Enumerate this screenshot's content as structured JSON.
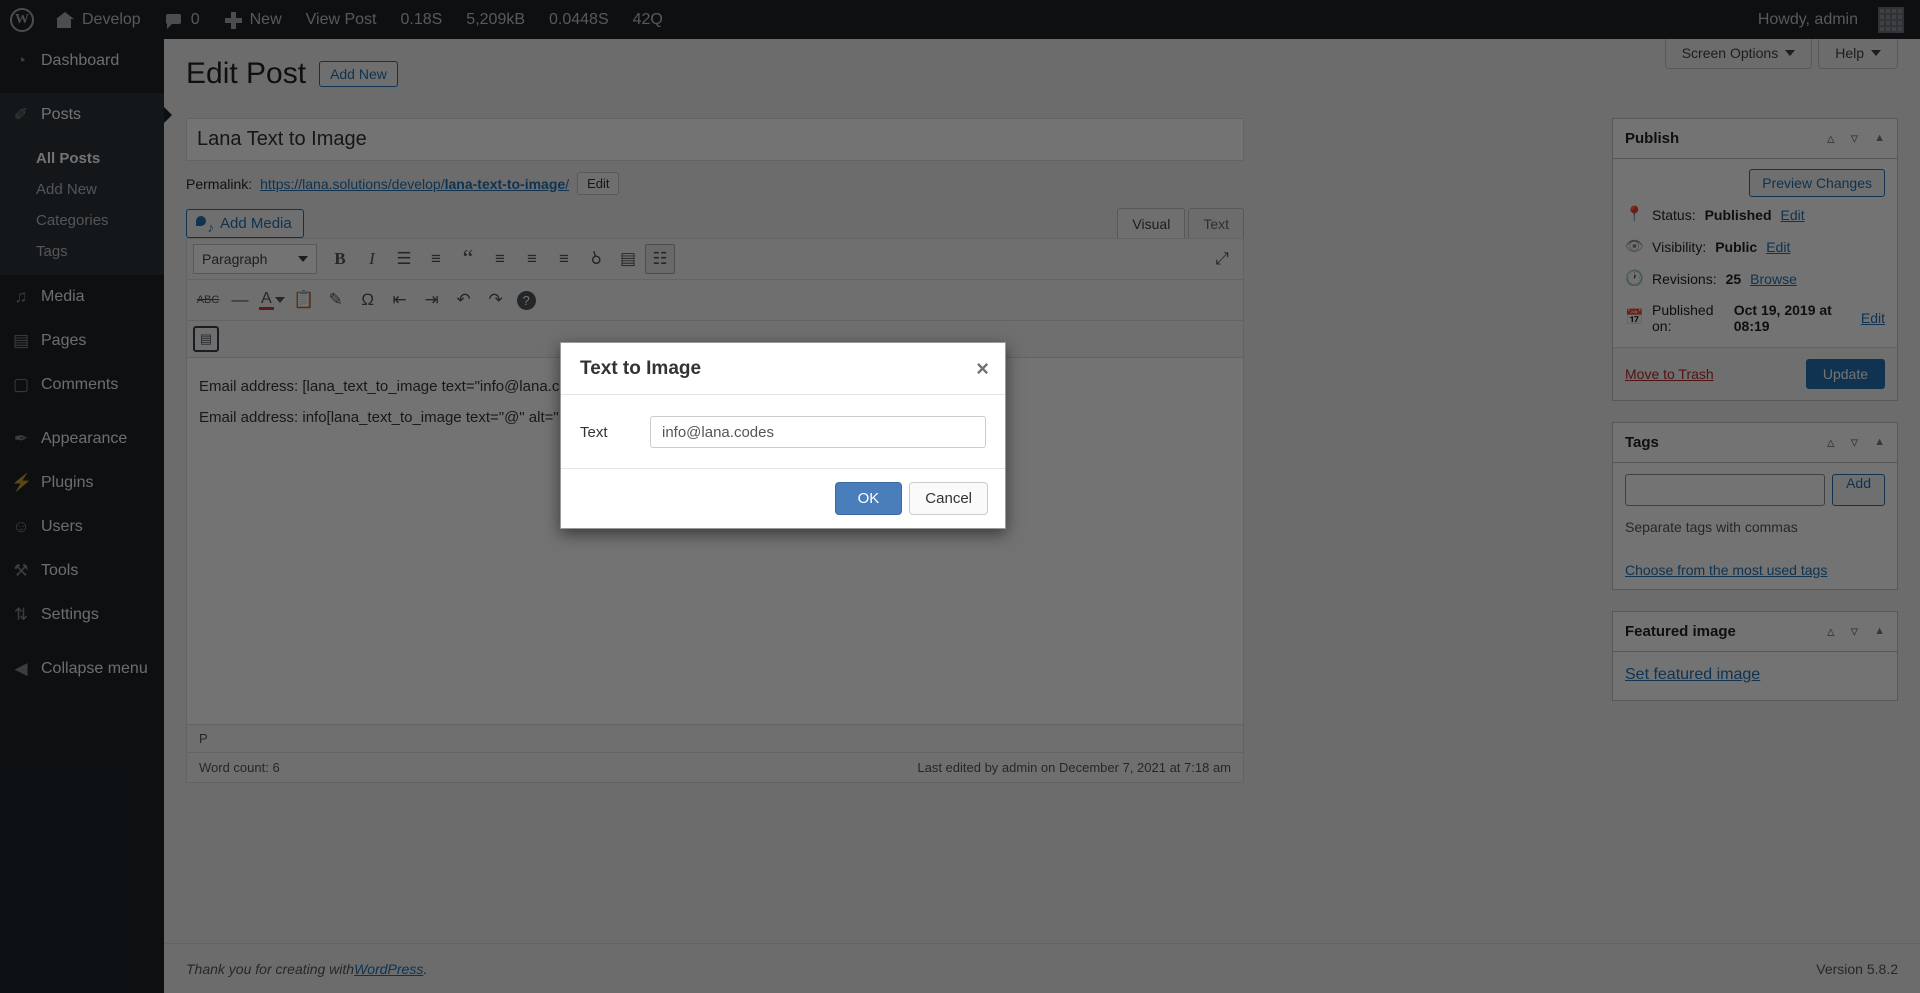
{
  "adminbar": {
    "logo_icon": "wordpress-logo-icon",
    "site_name": "Develop",
    "home_icon": "home-icon",
    "comments_icon": "comment-bubble-icon",
    "comment_count": "0",
    "new_icon": "plus-icon",
    "new_label": "New",
    "view_post": "View Post",
    "perf_time": "0.18S",
    "perf_memory": "5,209kB",
    "perf_query_time": "0.0448S",
    "perf_queries": "42Q",
    "howdy": "Howdy, admin",
    "avatar": "user-avatar"
  },
  "sidebar": {
    "items": [
      {
        "label": "Dashboard",
        "icon": "dashboard-icon",
        "glyph": "◔"
      },
      {
        "label": "Posts",
        "icon": "pin-icon",
        "glyph": "✐",
        "current": true
      },
      {
        "label": "Media",
        "icon": "media-icon",
        "glyph": "♫"
      },
      {
        "label": "Pages",
        "icon": "page-icon",
        "glyph": "▤"
      },
      {
        "label": "Comments",
        "icon": "comment-icon",
        "glyph": "▢"
      },
      {
        "label": "Appearance",
        "icon": "brush-icon",
        "glyph": "✒"
      },
      {
        "label": "Plugins",
        "icon": "plug-icon",
        "glyph": "⚡"
      },
      {
        "label": "Users",
        "icon": "user-icon",
        "glyph": "☺"
      },
      {
        "label": "Tools",
        "icon": "wrench-icon",
        "glyph": "⚒"
      },
      {
        "label": "Settings",
        "icon": "settings-icon",
        "glyph": "⇅"
      },
      {
        "label": "Collapse menu",
        "icon": "collapse-icon",
        "glyph": "◀"
      }
    ],
    "posts_submenu": [
      {
        "label": "All Posts",
        "current": true
      },
      {
        "label": "Add New",
        "current": false
      },
      {
        "label": "Categories",
        "current": false
      },
      {
        "label": "Tags",
        "current": false
      }
    ]
  },
  "screen_meta": {
    "screen_options": "Screen Options",
    "help": "Help"
  },
  "page": {
    "title": "Edit Post",
    "add_new": "Add New"
  },
  "editor": {
    "post_title": "Lana Text to Image",
    "permalink_label": "Permalink:",
    "permalink_base": "https://lana.solutions/develop/",
    "permalink_slug": "lana-text-to-image",
    "permalink_tail": "/",
    "permalink_edit": "Edit",
    "add_media": "Add Media",
    "tab_visual": "Visual",
    "tab_text": "Text",
    "format_select": "Paragraph",
    "toolbar_row1": [
      {
        "name": "bold-icon",
        "glyph": "B"
      },
      {
        "name": "italic-icon",
        "glyph": "I"
      },
      {
        "name": "bulleted-list-icon",
        "glyph": "☰"
      },
      {
        "name": "numbered-list-icon",
        "glyph": "≡"
      },
      {
        "name": "blockquote-icon",
        "glyph": "“"
      },
      {
        "name": "align-left-icon",
        "glyph": "≡"
      },
      {
        "name": "align-center-icon",
        "glyph": "≡"
      },
      {
        "name": "align-right-icon",
        "glyph": "≡"
      },
      {
        "name": "insert-link-icon",
        "glyph": "ὑ7"
      },
      {
        "name": "read-more-icon",
        "glyph": "▤"
      },
      {
        "name": "toolbar-toggle-icon",
        "glyph": "☷"
      }
    ],
    "toolbar_row2": [
      {
        "name": "strikethrough-icon",
        "glyph": "ABC"
      },
      {
        "name": "horizontal-rule-icon",
        "glyph": "—"
      },
      {
        "name": "text-color-icon",
        "glyph": "A"
      },
      {
        "name": "paste-as-text-icon",
        "glyph": "ὌB"
      },
      {
        "name": "clear-formatting-icon",
        "glyph": "✐"
      },
      {
        "name": "special-character-icon",
        "glyph": "Ω"
      },
      {
        "name": "decrease-indent-icon",
        "glyph": "⇤"
      },
      {
        "name": "increase-indent-icon",
        "glyph": "⇥"
      },
      {
        "name": "undo-icon",
        "glyph": "↶"
      },
      {
        "name": "redo-icon",
        "glyph": "↷"
      },
      {
        "name": "keyboard-shortcuts-icon",
        "glyph": "?"
      }
    ],
    "toolbar_row3": [
      {
        "name": "text-to-image-icon",
        "glyph": "▤"
      }
    ],
    "fullscreen_icon": "fullscreen-icon",
    "content_lines": [
      "Email address: [lana_text_to_image text=\"info@lana.codes\"]",
      "Email address: info[lana_text_to_image text=\"@\" alt=\"@\"]lana.codes"
    ],
    "element_path": "P",
    "word_count": "Word count: 6",
    "last_edited": "Last edited by admin on December 7, 2021 at 7:18 am"
  },
  "publish_box": {
    "title": "Publish",
    "preview_changes": "Preview Changes",
    "status_label": "Status:",
    "status_value": "Published",
    "status_edit": "Edit",
    "visibility_label": "Visibility:",
    "visibility_value": "Public",
    "visibility_edit": "Edit",
    "revisions_label": "Revisions:",
    "revisions_value": "25",
    "revisions_browse": "Browse",
    "published_label": "Published on:",
    "published_value": "Oct 19, 2019 at 08:19",
    "published_edit": "Edit",
    "move_to_trash": "Move to Trash",
    "update": "Update"
  },
  "tags_box": {
    "title": "Tags",
    "input_value": "",
    "add_label": "Add",
    "help": "Separate tags with commas",
    "most_used": "Choose from the most used tags"
  },
  "featured_box": {
    "title": "Featured image",
    "set_link": "Set featured image"
  },
  "footer": {
    "thanks_prefix": "Thank you for creating with ",
    "wordpress_link": "WordPress",
    "thanks_suffix": ".",
    "version": "Version 5.8.2"
  },
  "modal": {
    "title": "Text to Image",
    "close_icon": "close-icon",
    "field_label": "Text",
    "field_value": "info@lana.codes",
    "ok_label": "OK",
    "cancel_label": "Cancel"
  },
  "colors": {
    "admin_bar": "#1d2327",
    "sidebar": "#1d2327",
    "primary": "#2271b1",
    "modal_ok": "#4a7ebb",
    "trash": "#b32d2e"
  }
}
